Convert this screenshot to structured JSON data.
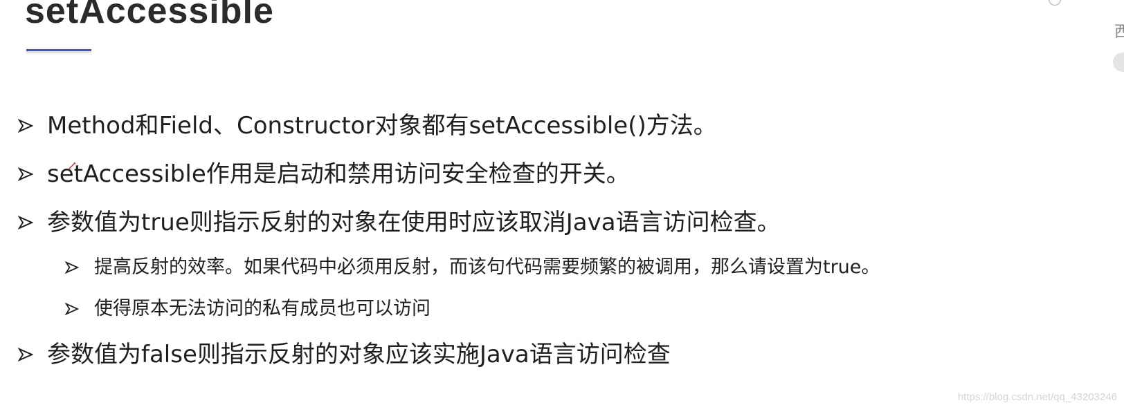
{
  "slide": {
    "title": "setAccessible",
    "accent_color": "#3d56c4"
  },
  "bullets": [
    {
      "text": "Method和Field、Constructor对象都有setAccessible()方法。"
    },
    {
      "text": "setAccessible作用是启动和禁用访问安全检查的开关。"
    },
    {
      "text": "参数值为true则指示反射的对象在使用时应该取消Java语言访问检查。"
    },
    {
      "text": "提高反射的效率。如果代码中必须用反射，而该句代码需要频繁的被调用，那么请设置为true。"
    },
    {
      "text": "使得原本无法访问的私有成员也可以访问"
    },
    {
      "text": "参数值为false则指示反射的对象应该实施Java语言访问检查"
    }
  ],
  "edge": {
    "glyph": "西"
  },
  "watermark": "https://blog.csdn.net/qq_43203246",
  "icons": [
    "arrow-bullet-icon",
    "pen-cursor-icon"
  ]
}
